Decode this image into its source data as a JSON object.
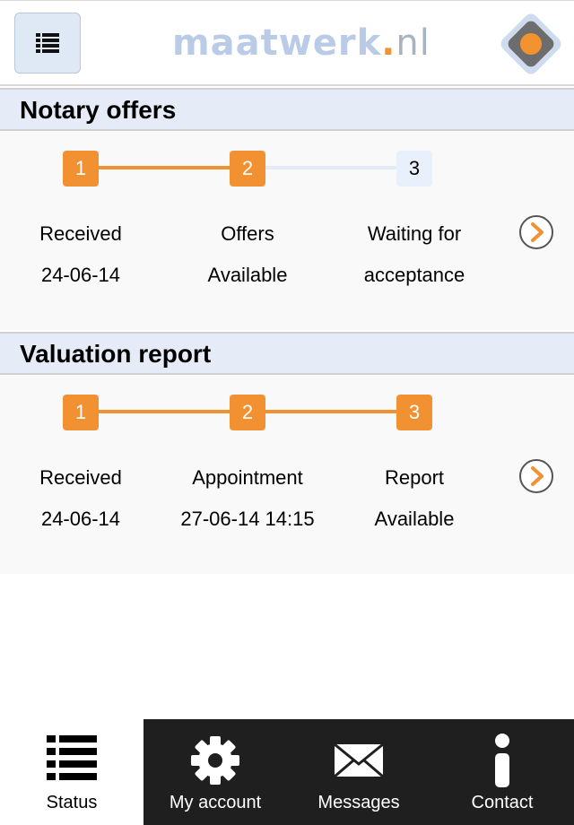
{
  "header": {
    "logo_part1": "maatwerk",
    "logo_dot": ".",
    "logo_part2": "nl"
  },
  "sections": [
    {
      "title": "Notary offers",
      "steps": [
        {
          "number": "1",
          "line1": "Received",
          "line2": "24-06-14",
          "done": true
        },
        {
          "number": "2",
          "line1": "Offers",
          "line2": "Available",
          "done": true
        },
        {
          "number": "3",
          "line1": "Waiting for",
          "line2": "acceptance",
          "done": false
        }
      ]
    },
    {
      "title": "Valuation report",
      "steps": [
        {
          "number": "1",
          "line1": "Received",
          "line2": "24-06-14",
          "done": true
        },
        {
          "number": "2",
          "line1": "Appointment",
          "line2": "27-06-14 14:15",
          "done": true
        },
        {
          "number": "3",
          "line1": "Report",
          "line2": "Available",
          "done": true
        }
      ]
    }
  ],
  "tabs": [
    {
      "label": "Status",
      "icon": "list-icon",
      "active": true
    },
    {
      "label": "My account",
      "icon": "gear-icon",
      "active": false
    },
    {
      "label": "Messages",
      "icon": "envelope-icon",
      "active": false
    },
    {
      "label": "Contact",
      "icon": "info-icon",
      "active": false
    }
  ],
  "colors": {
    "accent": "#f29131",
    "section_header_bg": "#e5ecf7",
    "pending_step_bg": "#e8f0fb",
    "tabbar_bg": "#1f1f1f"
  }
}
